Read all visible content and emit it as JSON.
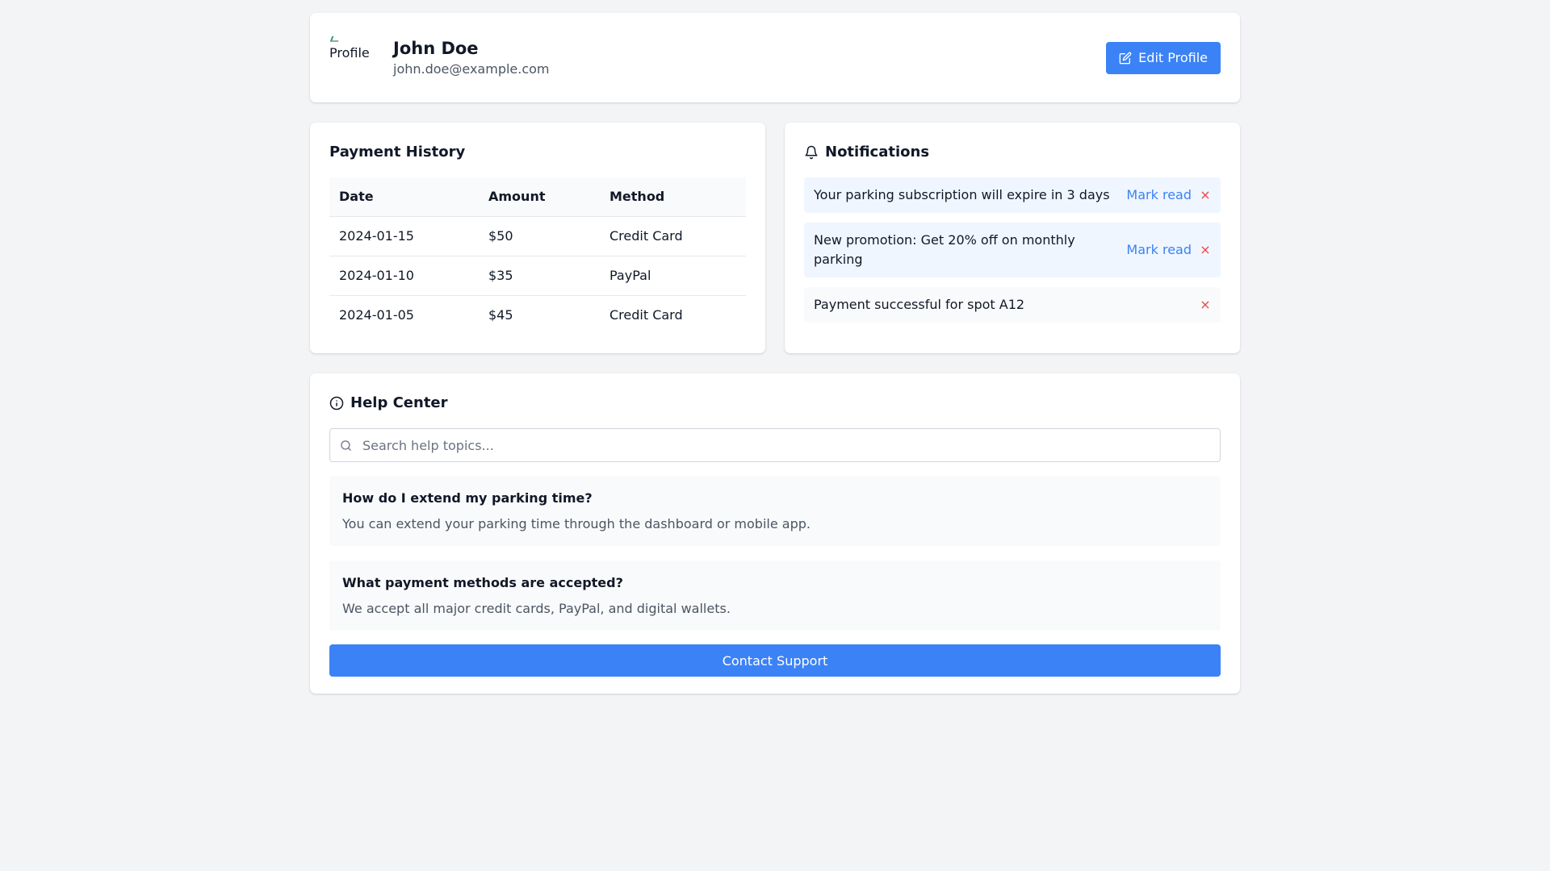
{
  "profile": {
    "avatar_alt": "Profile",
    "name": "John Doe",
    "email": "john.doe@example.com",
    "edit_label": "Edit Profile"
  },
  "payments": {
    "title": "Payment History",
    "headers": [
      "Date",
      "Amount",
      "Method"
    ],
    "rows": [
      [
        "2024-01-15",
        "$50",
        "Credit Card"
      ],
      [
        "2024-01-10",
        "$35",
        "PayPal"
      ],
      [
        "2024-01-05",
        "$45",
        "Credit Card"
      ]
    ]
  },
  "notifications": {
    "title": "Notifications",
    "mark_read_label": "Mark read",
    "dismiss_glyph": "×",
    "items": [
      {
        "text": "Your parking subscription will expire in 3 days",
        "read": false
      },
      {
        "text": "New promotion: Get 20% off on monthly parking",
        "read": false
      },
      {
        "text": "Payment successful for spot A12",
        "read": true
      }
    ]
  },
  "help": {
    "title": "Help Center",
    "search_placeholder": "Search help topics...",
    "faqs": [
      {
        "q": "How do I extend my parking time?",
        "a": "You can extend your parking time through the dashboard or mobile app."
      },
      {
        "q": "What payment methods are accepted?",
        "a": "We accept all major credit cards, PayPal, and digital wallets."
      }
    ],
    "contact_label": "Contact Support"
  },
  "colors": {
    "accent": "#3b82f6",
    "danger": "#ef4444",
    "background": "#f3f4f6",
    "unread_bg": "#eff6ff"
  },
  "icons": {
    "edit": "edit-icon",
    "bell": "bell-icon",
    "info": "info-icon",
    "search": "search-icon"
  }
}
